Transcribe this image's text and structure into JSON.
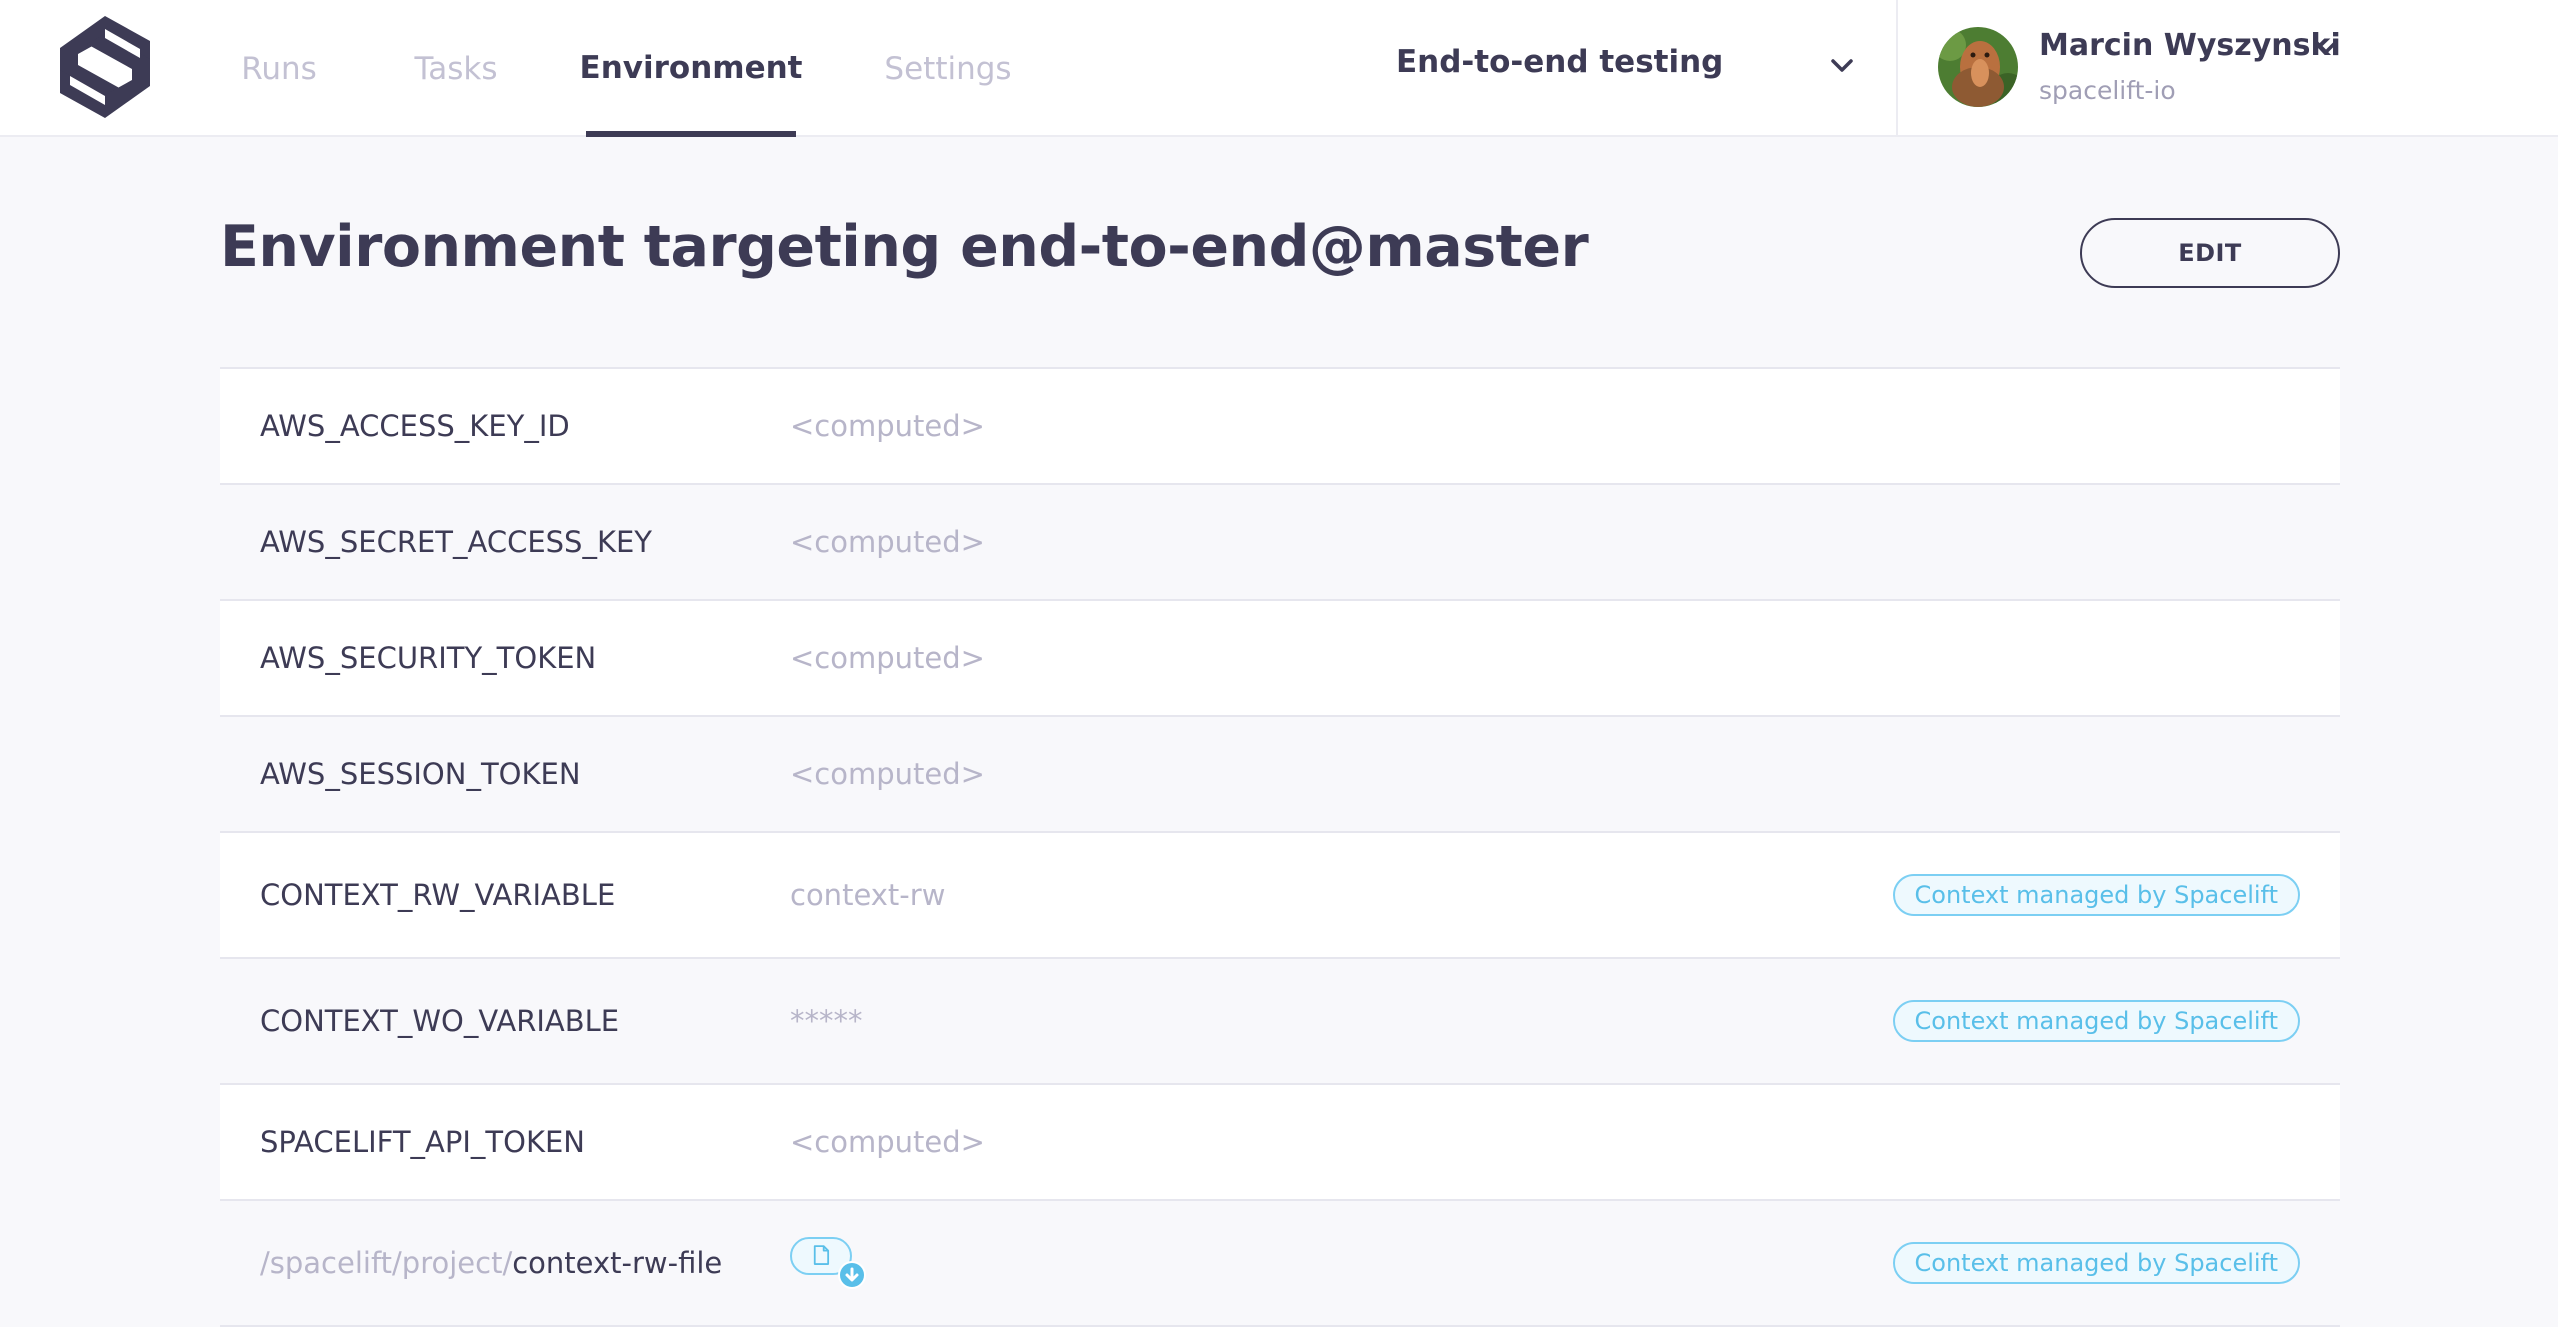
{
  "header": {
    "logo_name": "spacelift-logo",
    "tabs": [
      {
        "label": "Runs",
        "active": false
      },
      {
        "label": "Tasks",
        "active": false
      },
      {
        "label": "Environment",
        "active": true
      },
      {
        "label": "Settings",
        "active": false
      }
    ],
    "stack_selector": {
      "label": "End-to-end testing",
      "icon": "chevron-down-icon"
    },
    "user": {
      "name": "Marcin Wyszynski",
      "org": "spacelift-io",
      "icon": "chevron-down-icon"
    }
  },
  "page": {
    "title": "Environment targeting end-to-end@master",
    "edit_label": "EDIT"
  },
  "environment": {
    "rows": [
      {
        "name": "AWS_ACCESS_KEY_ID",
        "value": "<computed>"
      },
      {
        "name": "AWS_SECRET_ACCESS_KEY",
        "value": "<computed>"
      },
      {
        "name": "AWS_SECURITY_TOKEN",
        "value": "<computed>"
      },
      {
        "name": "AWS_SESSION_TOKEN",
        "value": "<computed>"
      },
      {
        "name": "CONTEXT_RW_VARIABLE",
        "value": "context-rw",
        "badge": "Context managed by Spacelift"
      },
      {
        "name": "CONTEXT_WO_VARIABLE",
        "value": "*****",
        "badge": "Context managed by Spacelift"
      },
      {
        "name": "SPACELIFT_API_TOKEN",
        "value": "<computed>"
      },
      {
        "path_prefix": "/spacelift/project/",
        "name": "context-rw-file",
        "file_icon": "file-download-icon",
        "badge": "Context managed by Spacelift"
      }
    ]
  },
  "colors": {
    "text_primary": "#3d3b55",
    "text_muted": "#b7b5c9",
    "badge_border": "#7ccff3",
    "badge_text": "#59bfe9",
    "background": "#f8f8fb"
  }
}
